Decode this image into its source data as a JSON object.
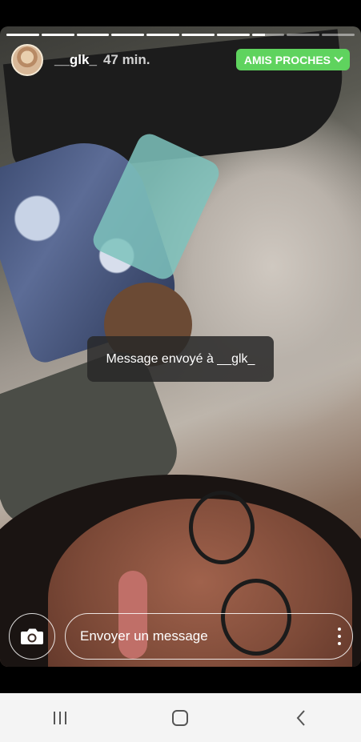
{
  "story": {
    "progress_segments": [
      1,
      1,
      1,
      1,
      1,
      1,
      1,
      0.4,
      0,
      0
    ],
    "username": "__glk_",
    "time_ago": "47 min.",
    "close_friends_label": "AMIS PROCHES"
  },
  "toast": {
    "text": "Message envoyé à __glk_"
  },
  "reply": {
    "placeholder": "Envoyer un message"
  },
  "icons": {
    "camera": "camera-icon",
    "more": "more-vertical-icon",
    "recent_apps": "recent-apps-icon",
    "home": "home-icon",
    "back": "back-icon"
  },
  "colors": {
    "close_friends_badge": "#5fd35e",
    "nav_bar_bg": "#f4f4f4"
  }
}
